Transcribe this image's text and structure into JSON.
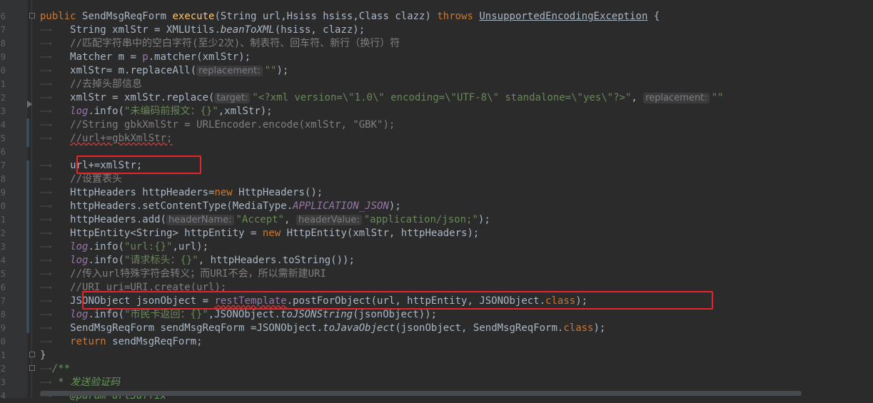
{
  "gutter_numbers": [
    "6",
    "7",
    "8",
    "9",
    "0",
    "1",
    "2",
    "3",
    "4",
    "5",
    "6",
    "7",
    "8",
    "9",
    "0",
    "1",
    "2",
    "3",
    "4",
    "5",
    "6",
    "7",
    "8",
    "9",
    "0",
    "1",
    "2",
    "3",
    "4"
  ],
  "code": {
    "l1_public": "public",
    "l1_class": "SendMsgReqForm",
    "l1_method": "execute",
    "l1_params": "(String url,Hsiss hsiss,Class clazz)",
    "l1_throws": "throws",
    "l1_exc": "UnsupportedEncodingException",
    "l1_brace": " {",
    "l2_a": "String xmlStr = XMLUtils.",
    "l2_b": "beanToXML",
    "l2_c": "(hsiss, clazz);",
    "l3": "//匹配字符串中的空白字符(至少2次)、制表符、回车符、新行（换行）符",
    "l4_a": "Matcher m = ",
    "l4_b": "p",
    "l4_c": ".matcher(xmlStr);",
    "l5_a": "xmlStr= m.replaceAll(",
    "l5_hint": "replacement:",
    "l5_str": "\"\"",
    "l5_c": ");",
    "l6": "//去掉头部信息",
    "l7_a": "xmlStr = xmlStr.replace(",
    "l7_hint1": "target:",
    "l7_str1": "\"<?xml version=\\\"1.0\\\" encoding=\\\"UTF-8\\\" standalone=\\\"yes\\\"?>\"",
    "l7_b": ", ",
    "l7_hint2": "replacement:",
    "l7_str2": "\"\"",
    "l8_a": "log",
    "l8_b": ".info(",
    "l8_str": "\"未编码前报文：{}\"",
    "l8_c": ",xmlStr);",
    "l9": "//String gbkXmlStr = URLEncoder.encode(xmlStr, \"GBK\");",
    "l10": "//url+=gbkXmlStr;",
    "l12": "url+=xmlStr;",
    "l13": "//设置表头",
    "l14_a": "HttpHeaders httpHeaders=",
    "l14_new": "new",
    "l14_b": " HttpHeaders();",
    "l15_a": "httpHeaders.setContentType(MediaType.",
    "l15_b": "APPLICATION_JSON",
    "l15_c": ");",
    "l16_a": "httpHeaders.add(",
    "l16_hint1": "headerName:",
    "l16_str1": "\"Accept\"",
    "l16_b": ", ",
    "l16_hint2": "headerValue:",
    "l16_str2": "\"application/json;\"",
    "l16_c": ");",
    "l17_a": "HttpEntity<String> httpEntity = ",
    "l17_new": "new",
    "l17_b": " HttpEntity(xmlStr, httpHeaders);",
    "l18_a": "log",
    "l18_b": ".info(",
    "l18_str": "\"url:{}\"",
    "l18_c": ",url);",
    "l19_a": "log",
    "l19_b": ".info(",
    "l19_str": "\"请求标头：{}\"",
    "l19_c": ", httpHeaders.toString());",
    "l20": "//传入url特殊字符会转义；而URI不会，所以需新建URI",
    "l21": "//URI uri=URI.create(url);",
    "l22_a": "JSONObject jsonObject = ",
    "l22_b": "restTemplate",
    "l22_c": ".postForObject(url, httpEntity, JSONObject.",
    "l22_cls": "class",
    "l22_d": ");",
    "l23_a": "log",
    "l23_b": ".info(",
    "l23_str": "\"市民卡返回：{}\"",
    "l23_c": ",JSONObject.",
    "l23_d": "toJSONString",
    "l23_e": "(jsonObject));",
    "l24_a": "SendMsgReqForm sendMsgReqForm =JSONObject.",
    "l24_b": "toJavaObject",
    "l24_c": "(jsonObject, SendMsgReqForm.",
    "l24_cls": "class",
    "l24_d": ");",
    "l25_kw": "return",
    "l25_b": " sendMsgReqForm;",
    "l26": "}",
    "l27": "/**",
    "l28": " * 发送验证码",
    "l29": " * @param urlSuffix"
  },
  "colors": {
    "background": "#2b2b2b",
    "keyword": "#cc7832",
    "string": "#6a8759",
    "comment": "#808080",
    "field": "#9876aa",
    "method": "#ffc66d",
    "highlight_box": "#e8232a"
  }
}
